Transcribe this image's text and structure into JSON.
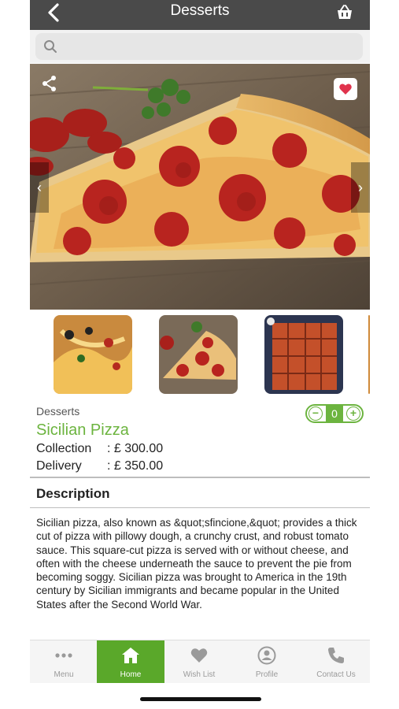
{
  "header": {
    "title": "Desserts",
    "back_icon": "chevron-left-icon",
    "basket_icon": "basket-icon"
  },
  "search": {
    "placeholder": "",
    "value": ""
  },
  "hero": {
    "share_icon": "share-icon",
    "favorite_icon": "heart-icon",
    "favorite_color": "#e0334d"
  },
  "product": {
    "category": "Desserts",
    "name": "Sicilian Pizza",
    "quantity": "0",
    "prices": [
      {
        "label": "Collection",
        "value": ": £ 300.00"
      },
      {
        "label": "Delivery",
        "value": ": £ 350.00"
      }
    ],
    "description_title": "Description",
    "description": "Sicilian pizza, also known as &quot;sfincione,&quot; provides a thick cut of pizza with pillowy dough, a crunchy crust, and robust tomato sauce. This square-cut pizza is served with or without cheese, and often with the cheese underneath the sauce to prevent the pie from becoming soggy. Sicilian pizza was brought to America in the 19th century by Sicilian immigrants and became popular in the United States after the Second World War."
  },
  "tabs": [
    {
      "label": "Menu",
      "icon": "more-dots-icon"
    },
    {
      "label": "Home",
      "icon": "home-icon",
      "active": true
    },
    {
      "label": "Wish List",
      "icon": "heart-icon"
    },
    {
      "label": "Profile",
      "icon": "profile-icon"
    },
    {
      "label": "Contact Us",
      "icon": "phone-icon"
    }
  ],
  "colors": {
    "accent": "#6cb43f",
    "active_tab": "#5aa82a",
    "header": "#4a4a4a"
  }
}
